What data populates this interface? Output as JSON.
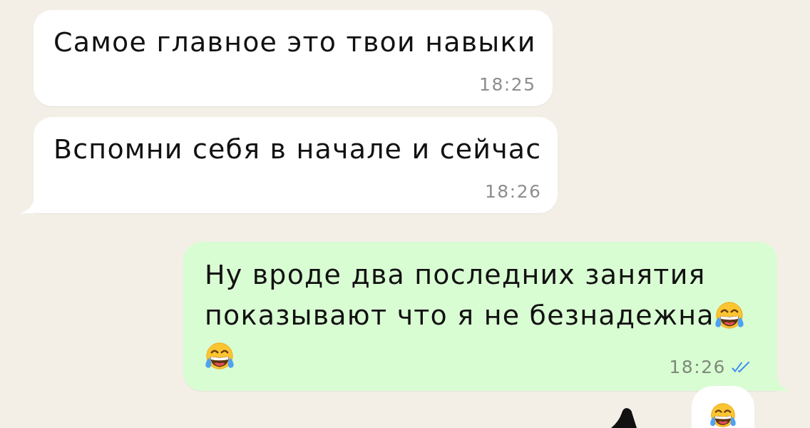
{
  "messages": [
    {
      "outgoing": false,
      "tail": false,
      "parts": [
        {
          "kind": "text",
          "text": "Самое главное это твои навыки"
        }
      ],
      "time": "18:25"
    },
    {
      "outgoing": false,
      "tail": true,
      "parts": [
        {
          "kind": "text",
          "text": "Вспомни себя в начале и сейчас"
        }
      ],
      "time": "18:26"
    },
    {
      "outgoing": true,
      "tail": true,
      "parts": [
        {
          "kind": "text",
          "text": "Ну вроде два последних занятия показывают что я не безнадежна"
        },
        {
          "kind": "emoji"
        },
        {
          "kind": "emoji"
        }
      ],
      "time": "18:26",
      "read": true,
      "reactions": [
        {
          "kind": "emoji"
        }
      ]
    }
  ]
}
